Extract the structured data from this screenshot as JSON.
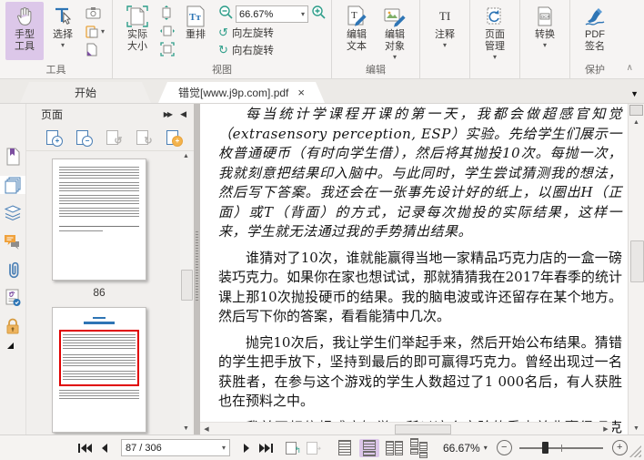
{
  "ribbon": {
    "hand_tool": "手型工具",
    "select": "选择",
    "tools_group": "工具",
    "actual_size": "实际大小",
    "reflow": "重排",
    "zoom_value": "66.67%",
    "rotate_left": "向左旋转",
    "rotate_right": "向右旋转",
    "view_group": "视图",
    "edit_text": "编辑文本",
    "edit_object": "编辑对象",
    "edit_group": "编辑",
    "comment": "注释",
    "page_mgmt": "页面管理",
    "convert": "转换",
    "pdf_sign_line1": "PDF",
    "pdf_sign_line2": "签名",
    "protect_group": "保护"
  },
  "tabs": {
    "start": "开始",
    "document": "错觉[www.j9p.com].pdf"
  },
  "left_panel": {
    "title": "页面",
    "page86_label": "86"
  },
  "document": {
    "paragraphs": [
      "每当统计学课程开课的第一天，我都会做超感官知觉（extrasensory perception, ESP）实验。先给学生们展示一枚普通硬币（有时向学生借），然后将其抛投10次。每抛一次，我就刻意把结果印入脑中。与此同时，学生尝试猜测我的想法，然后写下答案。我还会在一张事先设计好的纸上，以圈出H（正面）或T（背面）的方式，记录每次抛投的实际结果，这样一来，学生就无法通过我的手势猜出结果。",
      "谁猜对了10次，谁就能赢得当地一家精品巧克力店的一盒一磅装巧克力。如果你在家也想试试，那就猜猜我在2017年春季的统计课上那10次抛投硬币的结果。我的脑电波或许还留存在某个地方。然后写下你的答案，看看能猜中几次。",
      "抛完10次后，我让学生们举起手来，然后开始公布结果。猜错的学生把手放下，坚持到最后的即可赢得巧克力。曾经出现过一名获胜者，在参与这个游戏的学生人数超过了1 000名后，有人获胜也在预料之中。",
      "我并不相信超感官知觉，所以这个实验的重点并非赢得巧克力。"
    ]
  },
  "status_bar": {
    "page_indicator": "87 / 306",
    "zoom_value": "66.67%"
  },
  "icons": {
    "close": "×",
    "caret_down": "▾",
    "tri_down": "▼",
    "collapse_up": "∧",
    "fast_forward": "▶▶",
    "collapse_left": "◀",
    "up": "▲",
    "down": "▼",
    "left": "◀",
    "right": "▶",
    "rotate_left": "↺",
    "rotate_right": "↻",
    "zoom_out": "–",
    "zoom_in": "+",
    "reflow_glyph": "Tт",
    "comment_glyph": "TI",
    "ocr": "OCR",
    "minus": "−",
    "plus": "+"
  }
}
